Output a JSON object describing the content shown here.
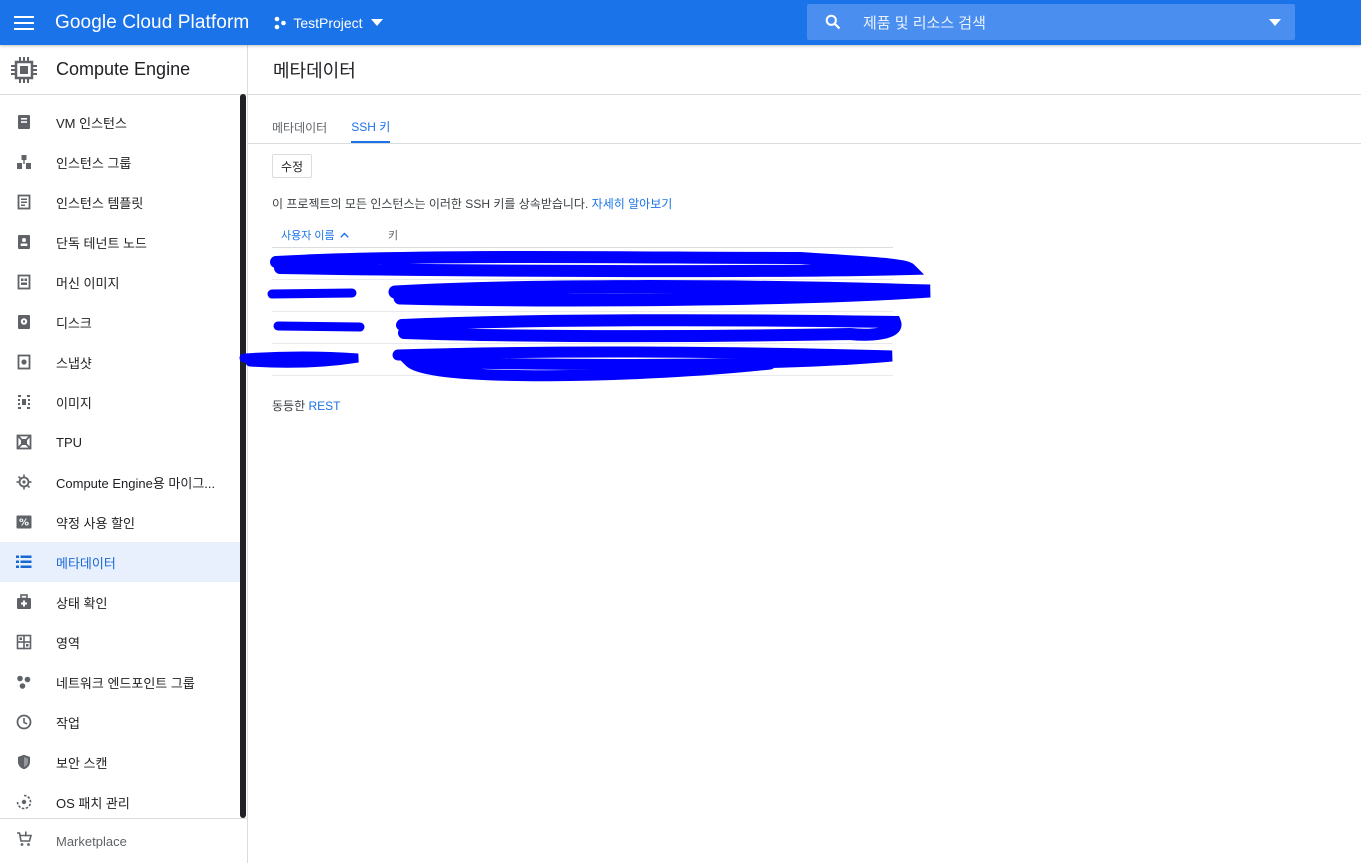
{
  "topbar": {
    "brand": "Google Cloud Platform",
    "project": "TestProject",
    "search_placeholder": "제품 및 리소스 검색",
    "bg_color": "#1a73e8"
  },
  "sidebar": {
    "title": "Compute Engine",
    "items": [
      {
        "label": "VM 인스턴스",
        "icon": "vm-instance-icon"
      },
      {
        "label": "인스턴스 그룹",
        "icon": "instance-group-icon"
      },
      {
        "label": "인스턴스 템플릿",
        "icon": "instance-template-icon"
      },
      {
        "label": "단독 테넌트 노드",
        "icon": "sole-tenant-node-icon"
      },
      {
        "label": "머신 이미지",
        "icon": "machine-image-icon"
      },
      {
        "label": "디스크",
        "icon": "disk-icon"
      },
      {
        "label": "스냅샷",
        "icon": "snapshot-icon"
      },
      {
        "label": "이미지",
        "icon": "image-icon"
      },
      {
        "label": "TPU",
        "icon": "tpu-icon"
      },
      {
        "label": "Compute Engine용 마이그...",
        "icon": "migrate-icon"
      },
      {
        "label": "약정 사용 할인",
        "icon": "percent-icon"
      },
      {
        "label": "메타데이터",
        "icon": "metadata-list-icon",
        "active": true
      },
      {
        "label": "상태 확인",
        "icon": "health-check-icon"
      },
      {
        "label": "영역",
        "icon": "zone-icon"
      },
      {
        "label": "네트워크 엔드포인트 그룹",
        "icon": "network-endpoint-icon"
      },
      {
        "label": "작업",
        "icon": "clock-icon"
      },
      {
        "label": "보안 스캔",
        "icon": "shield-icon"
      },
      {
        "label": "OS 패치 관리",
        "icon": "os-patch-icon"
      }
    ],
    "footer": "Marketplace"
  },
  "main": {
    "title": "메타데이터",
    "tabs": [
      {
        "label": "메타데이터",
        "active": false
      },
      {
        "label": "SSH 키",
        "active": true
      }
    ],
    "edit_button": "수정",
    "description": "이 프로젝트의 모든 인스턴스는 이러한 SSH 키를 상속받습니다.",
    "learn_more": "자세히 알아보기",
    "table": {
      "col_user": "사용자 이름",
      "col_key": "키",
      "row_count": 4
    },
    "rest_prefix": "동등한",
    "rest_link": "REST"
  }
}
